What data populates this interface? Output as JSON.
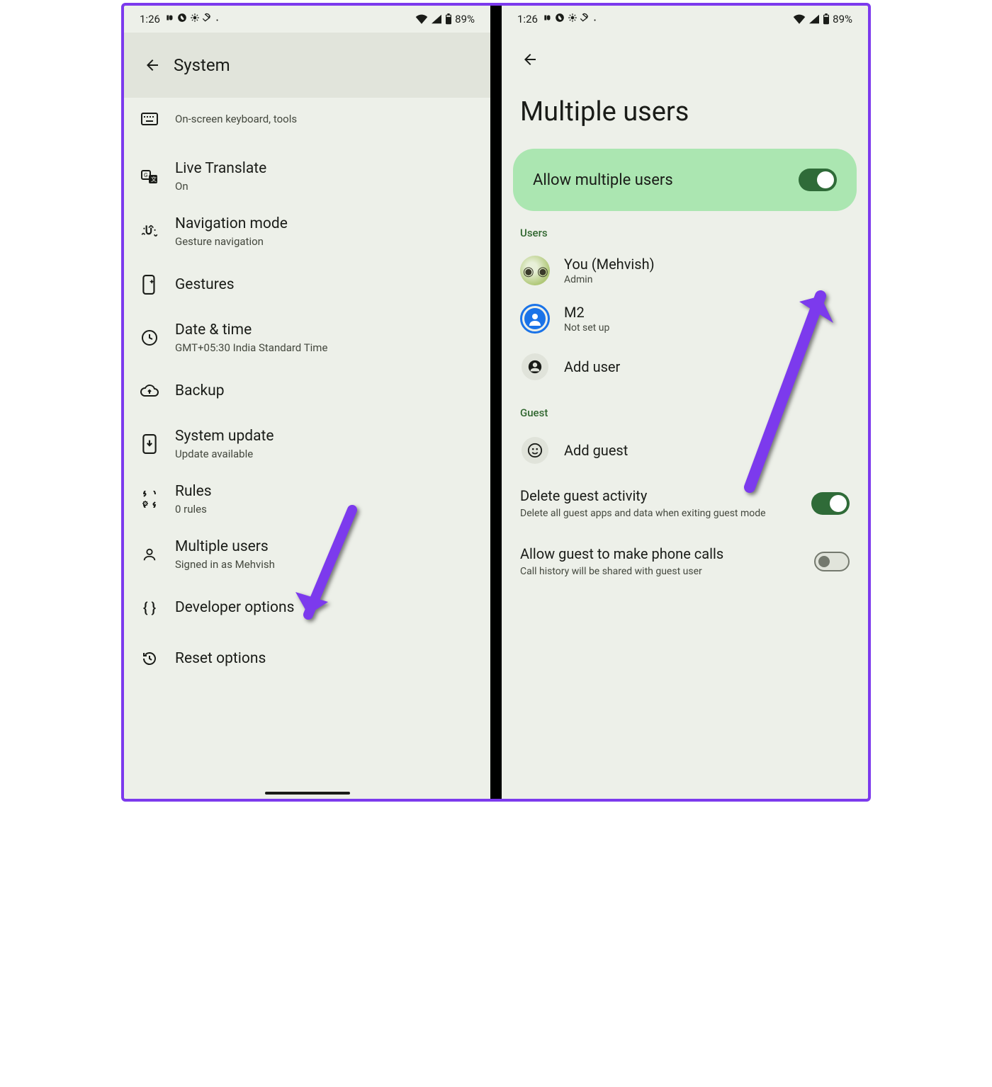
{
  "statusbar": {
    "time": "1:26",
    "battery": "89%"
  },
  "screen1": {
    "header_title": "System",
    "items": [
      {
        "title": "",
        "sub": "On-screen keyboard, tools"
      },
      {
        "title": "Live Translate",
        "sub": "On"
      },
      {
        "title": "Navigation mode",
        "sub": "Gesture navigation"
      },
      {
        "title": "Gestures",
        "sub": ""
      },
      {
        "title": "Date & time",
        "sub": "GMT+05:30 India Standard Time"
      },
      {
        "title": "Backup",
        "sub": ""
      },
      {
        "title": "System update",
        "sub": "Update available"
      },
      {
        "title": "Rules",
        "sub": "0 rules"
      },
      {
        "title": "Multiple users",
        "sub": "Signed in as Mehvish"
      },
      {
        "title": "Developer options",
        "sub": ""
      },
      {
        "title": "Reset options",
        "sub": ""
      }
    ]
  },
  "screen2": {
    "page_title": "Multiple users",
    "allow_label": "Allow multiple users",
    "sections": {
      "users_header": "Users",
      "guest_header": "Guest"
    },
    "users": [
      {
        "title": "You (Mehvish)",
        "sub": "Admin"
      },
      {
        "title": "M2",
        "sub": "Not set up"
      },
      {
        "title": "Add user",
        "sub": ""
      }
    ],
    "guest": {
      "add_guest": "Add guest",
      "delete_activity_title": "Delete guest activity",
      "delete_activity_sub": "Delete all guest apps and data when exiting guest mode",
      "phone_calls_title": "Allow guest to make phone calls",
      "phone_calls_sub": "Call history will be shared with guest user"
    }
  },
  "colors": {
    "accent_arrow": "#7c3aed",
    "toggle_on": "#2f6b38",
    "card_bg": "#abe6b1"
  }
}
